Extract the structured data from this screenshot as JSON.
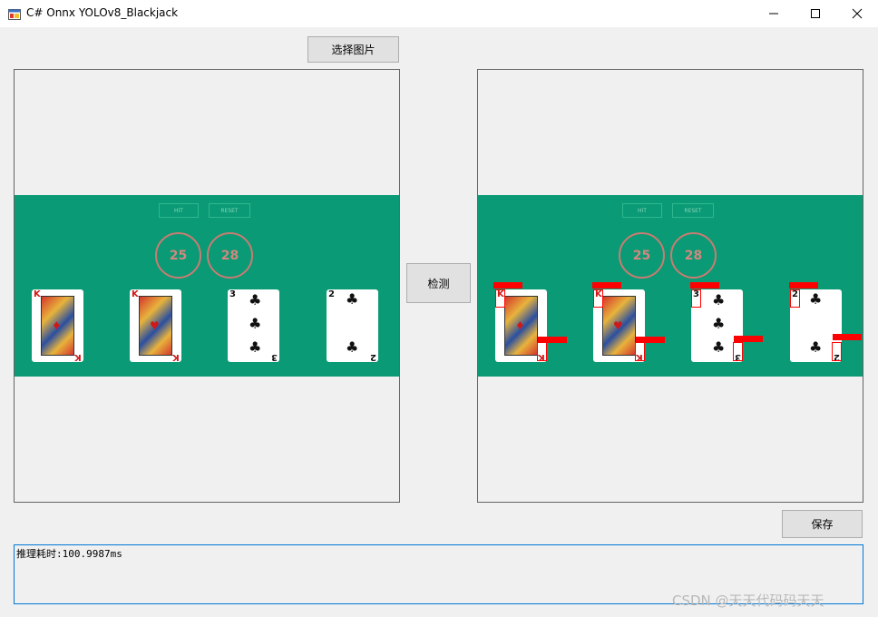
{
  "window": {
    "title": "C# Onnx YOLOv8_Blackjack",
    "icon": "app-window-icon"
  },
  "toolbar": {
    "select_image_label": "选择图片",
    "detect_label": "检测",
    "save_label": "保存"
  },
  "game": {
    "hit_label": "HIT",
    "reset_label": "RESET",
    "scores": [
      "25",
      "28"
    ],
    "cards": [
      {
        "rank": "K",
        "suit": "♦",
        "color": "red"
      },
      {
        "rank": "K",
        "suit": "♥",
        "color": "red"
      },
      {
        "rank": "3",
        "suit": "♣",
        "color": "black"
      },
      {
        "rank": "2",
        "suit": "♣",
        "color": "black"
      }
    ],
    "table_color": "#0a9a75",
    "detection_box_color": "#ff0000"
  },
  "log": {
    "text": "推理耗时:100.9987ms"
  },
  "watermark": "CSDN @天天代码码天天"
}
